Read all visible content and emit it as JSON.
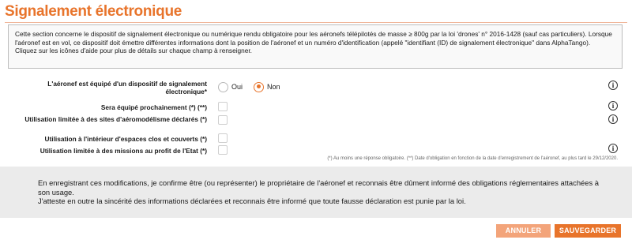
{
  "page": {
    "title": "Signalement électronique"
  },
  "info": {
    "line1": "Cette section concerne le dispositif de signalement électronique ou numérique rendu obligatoire pour les aéronefs télépilotés de masse ≥ 800g par la loi 'drones' n° 2016-1428 (sauf cas particuliers). Lorsque l'aéronef est en vol, ce dispositif doit émettre différentes informations dont la position de l'aéronef et un numéro d'identification (appelé \"identifiant (ID) de signalement électronique\" dans AlphaTango).",
    "line2": "Cliquez sur les icônes d'aide pour plus de détails sur chaque champ à renseigner."
  },
  "form": {
    "equipped": {
      "label": "L'aéronef est équipé d'un dispositif de signalement électronique*",
      "options": [
        "Oui",
        "Non"
      ],
      "selected": "Non",
      "help_icon": "info-icon"
    },
    "soon": {
      "label": "Sera équipé prochainement (*) (**)",
      "checked": false,
      "help_icon": "info-icon"
    },
    "model_sites": {
      "label": "Utilisation limitée à des sites d'aéromodélisme déclarés (*)",
      "checked": false,
      "help_icon": "info-icon"
    },
    "indoor": {
      "label": "Utilisation à l'intérieur d'espaces clos et couverts (*)",
      "checked": false
    },
    "state_missions": {
      "label": "Utilisation limitée à des missions au profit de l'Etat (*)",
      "checked": false,
      "help_icon": "info-icon"
    },
    "footnote": "(*) Au moins une réponse obligatoire. (**) Date d'obligation en fonction de la date d'enregistrement de l'aéronef, au plus tard le 29/12/2020."
  },
  "consent": {
    "line1": "En enregistrant ces modifications, je confirme être (ou représenter) le propriétaire de l'aéronef et reconnais être dûment informé des obligations réglementaires attachées à son usage.",
    "line2": "J'atteste en outre la sincérité des informations déclarées et reconnais être informé que toute fausse déclaration est punie par la loi."
  },
  "actions": {
    "cancel_label": "ANNULER",
    "save_label": "SAUVEGARDER"
  },
  "colors": {
    "accent": "#e8742b",
    "accent_light": "#f3a47a"
  }
}
